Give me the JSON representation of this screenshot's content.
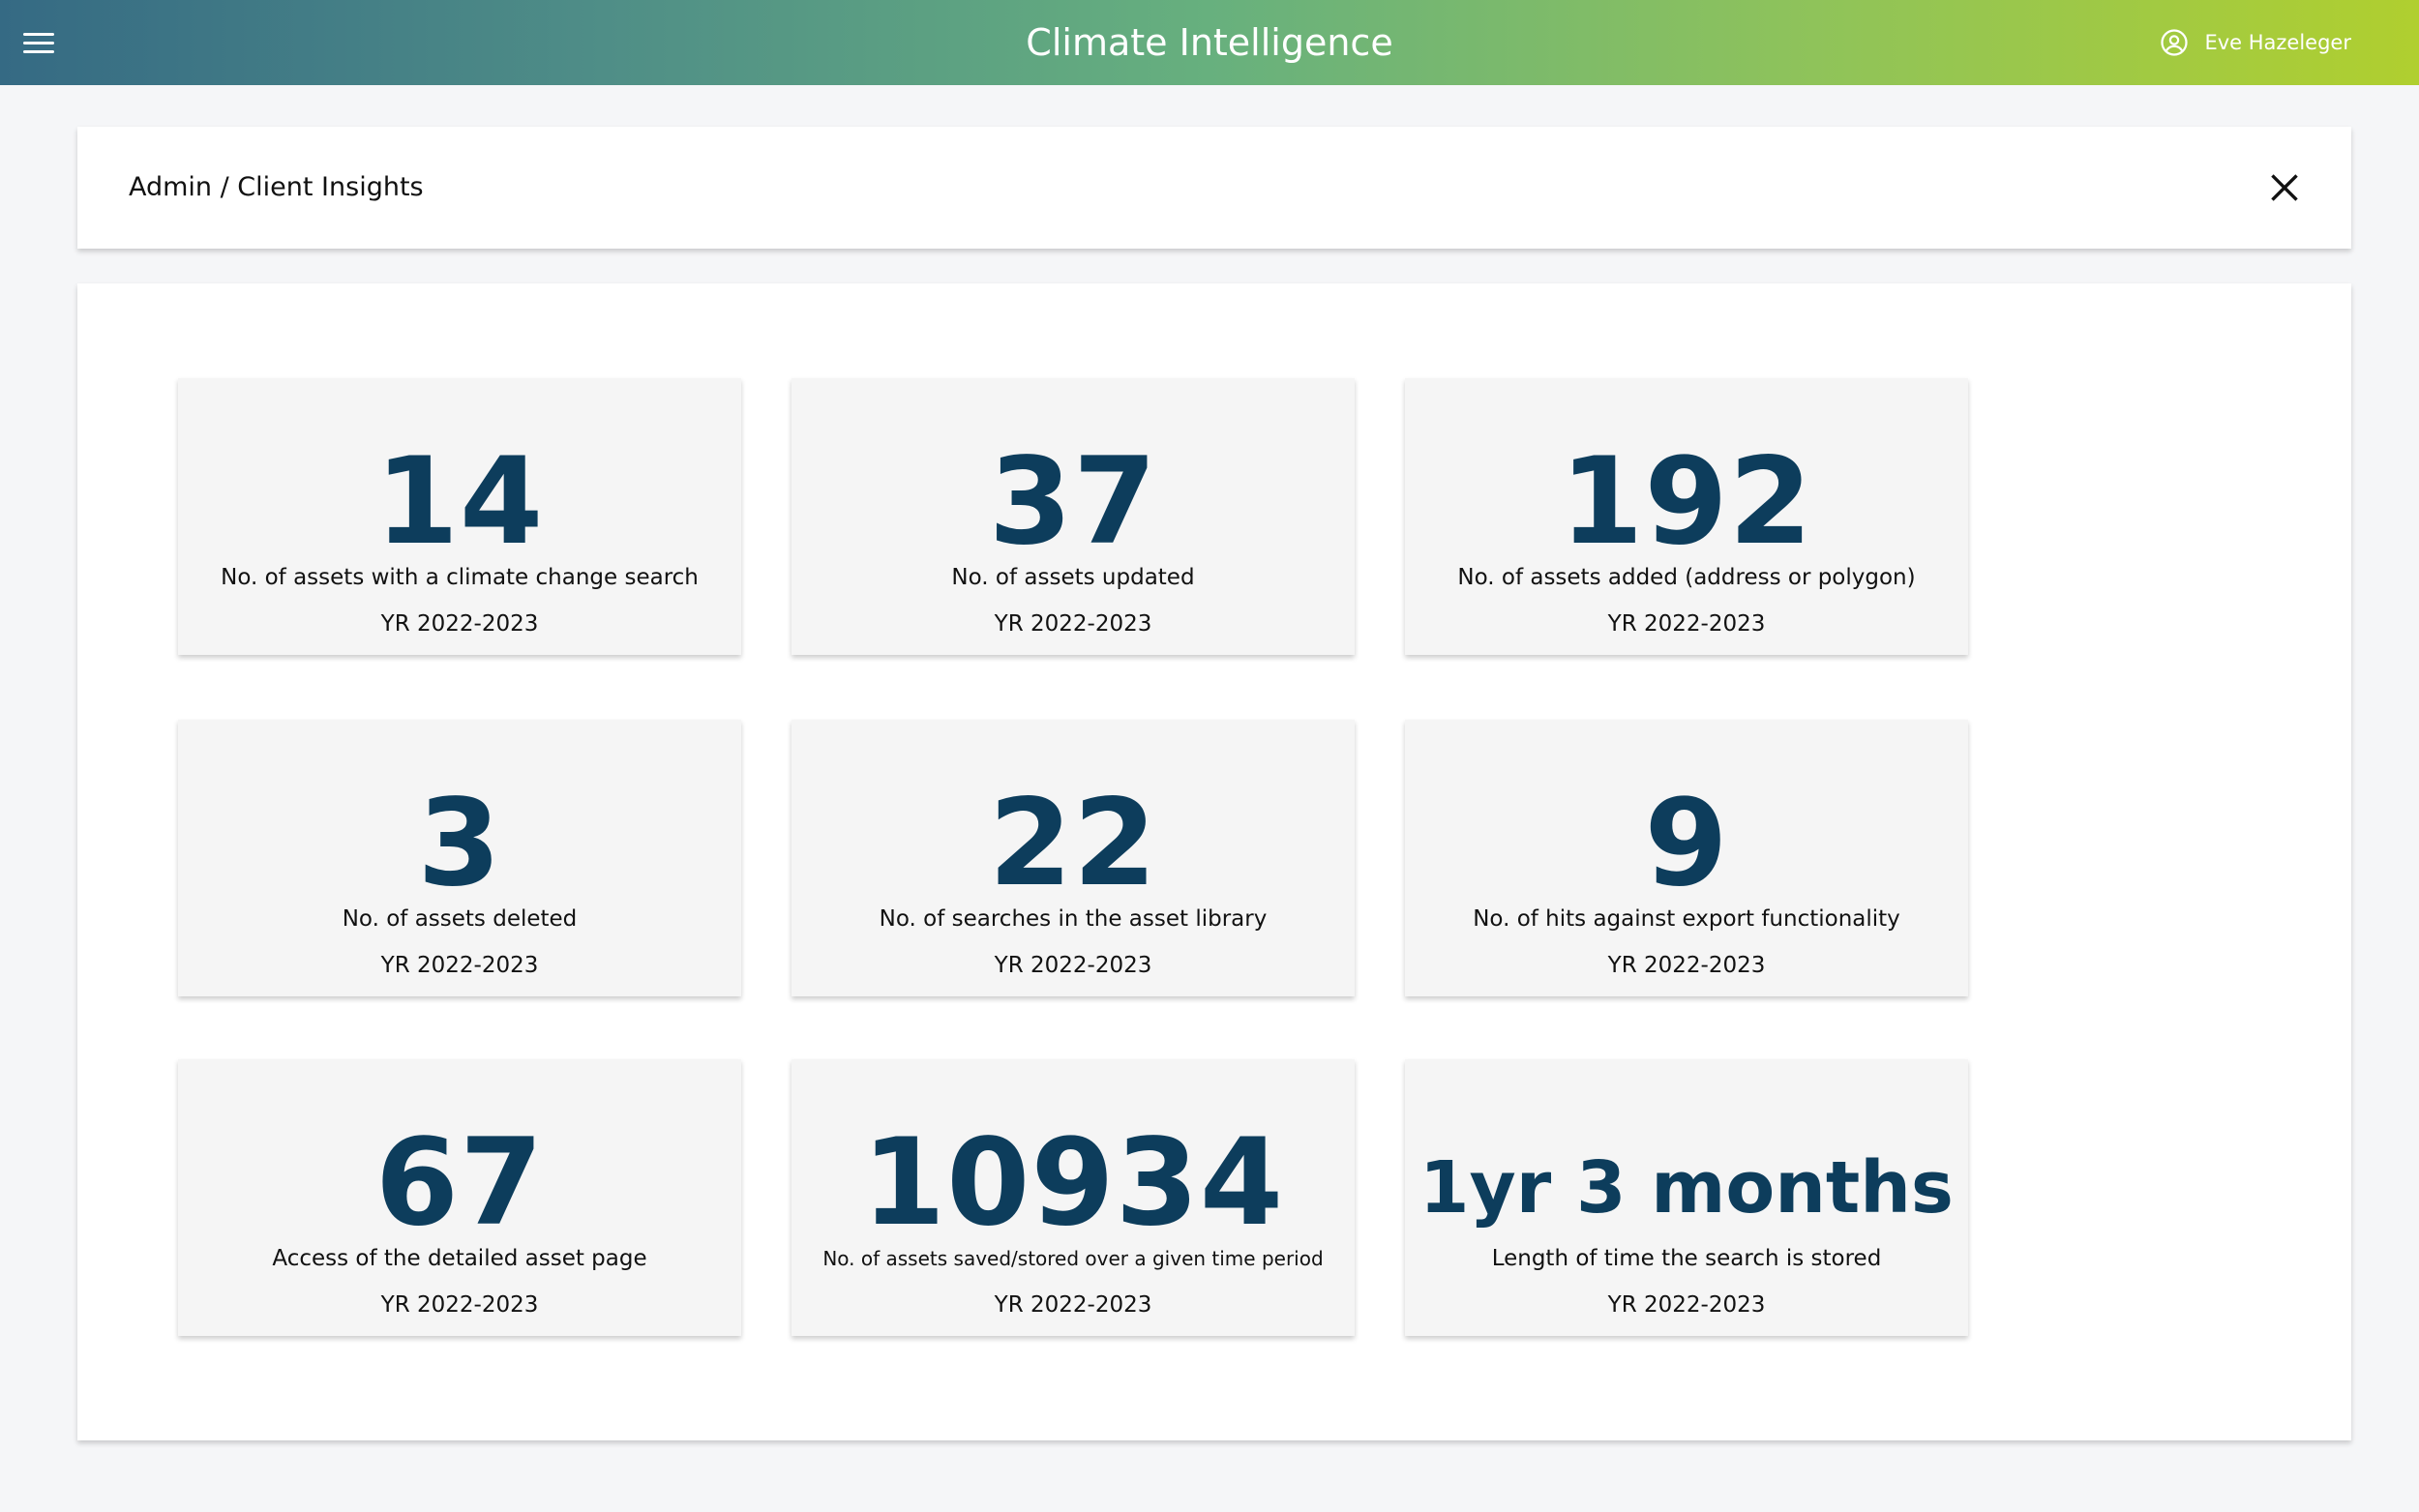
{
  "app": {
    "title": "Climate Intelligence",
    "user_name": "Eve Hazeleger",
    "menu_icon": "hamburger-menu-icon",
    "user_icon": "user-circle-icon"
  },
  "breadcrumb": {
    "text": "Admin / Client Insights",
    "close_icon": "close-icon"
  },
  "colors": {
    "header_gradient_start": "#356a84",
    "header_gradient_end": "#b0cf2f",
    "stat_value": "#0d3d5c",
    "card_background": "#f5f5f5"
  },
  "stats": [
    {
      "value": "14",
      "label": "No. of assets with a climate change search",
      "period": "YR 2022-2023"
    },
    {
      "value": "37",
      "label": "No. of assets updated",
      "period": "YR 2022-2023"
    },
    {
      "value": "192",
      "label": "No. of assets added (address or polygon)",
      "period": "YR 2022-2023"
    },
    {
      "value": "3",
      "label": "No. of assets deleted",
      "period": "YR 2022-2023"
    },
    {
      "value": "22",
      "label": "No. of searches in the asset library",
      "period": "YR 2022-2023"
    },
    {
      "value": "9",
      "label": "No. of hits against export functionality",
      "period": "YR 2022-2023"
    },
    {
      "value": "67",
      "label": "Access of the detailed asset page",
      "period": "YR 2022-2023"
    },
    {
      "value": "10934",
      "label": "No. of  assets saved/stored over a given time period",
      "period": "YR 2022-2023"
    },
    {
      "value": "1yr 3 months",
      "label": "Length of time the search is stored",
      "period": "YR 2022-2023"
    }
  ]
}
